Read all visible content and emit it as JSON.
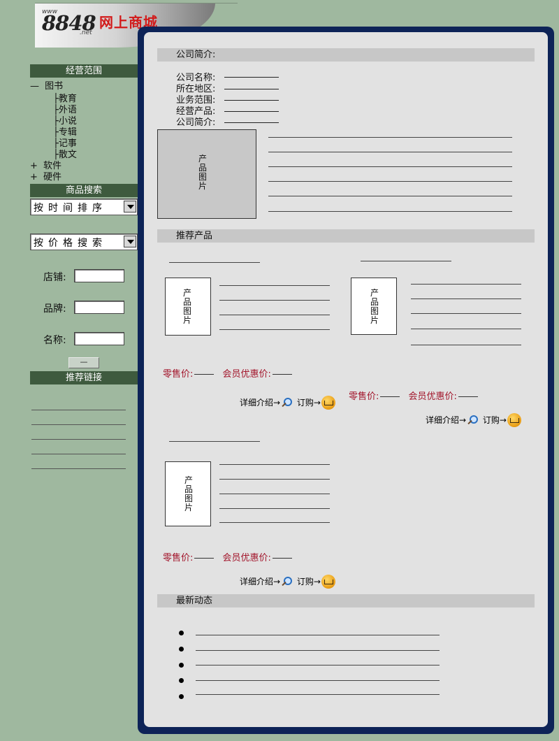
{
  "logo": {
    "www": "www",
    "number": "8848",
    "net": ".net",
    "text": "网上商城"
  },
  "sidebar": {
    "business_scope": {
      "title": "经营范围",
      "books": {
        "toggle": "—",
        "label": "图书"
      },
      "book_children": [
        "教育",
        "外语",
        "小说",
        "专辑",
        "记事",
        "散文"
      ],
      "tree_branch": "├",
      "software": {
        "toggle": "+",
        "label": "软件"
      },
      "hardware": {
        "toggle": "+",
        "label": "硬件"
      }
    },
    "product_search": {
      "title": "商品搜索",
      "sort_select": "按时间排序",
      "price_select": "按价格搜索",
      "store_label": "店铺:",
      "brand_label": "品牌:",
      "name_label": "名称:",
      "submit_label": "—"
    },
    "links": {
      "title": "推荐链接"
    }
  },
  "company": {
    "section_title": "公司简介:",
    "fields": [
      "公司名称:",
      "所在地区:",
      "业务范围:",
      "经营产品:",
      "公司简介:"
    ],
    "photo_label": "产品图片"
  },
  "recommended": {
    "section_title": "推荐产品",
    "products": [
      {
        "photo_label": "产品图片",
        "retail_label": "零售价:",
        "member_label": "会员优惠价:",
        "detail_label": "详细介绍",
        "order_label": "订购"
      },
      {
        "photo_label": "产品图片",
        "retail_label": "零售价:",
        "member_label": "会员优惠价:",
        "detail_label": "详细介绍",
        "order_label": "订购"
      },
      {
        "photo_label": "产品图片",
        "retail_label": "零售价:",
        "member_label": "会员优惠价:",
        "detail_label": "详细介绍",
        "order_label": "订购"
      }
    ],
    "arrow": "→"
  },
  "news": {
    "section_title": "最新动态"
  },
  "colors": {
    "page_bg": "#9fb89f",
    "sidebar_header": "#3e5a3e",
    "frame": "#0d2357",
    "content_bg": "#e2e2e2",
    "section_header": "#c7c7c7",
    "price_text": "#a2142a",
    "logo_red": "#d21b1b"
  },
  "icons": [
    "magnifier-icon",
    "shopping-cart-icon",
    "dropdown-arrow-icon",
    "bullet-icon"
  ]
}
